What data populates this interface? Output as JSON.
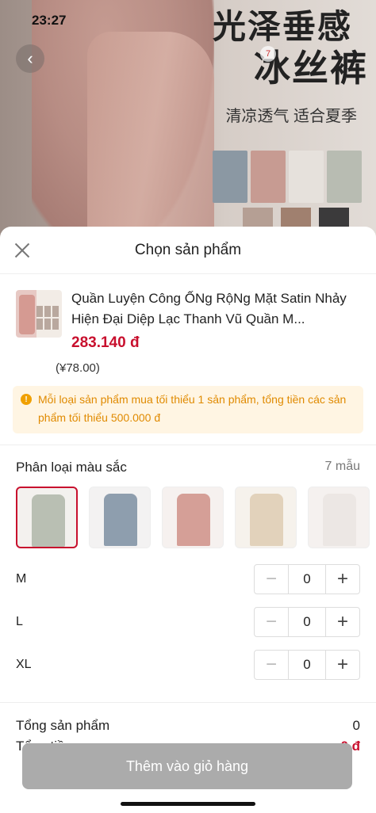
{
  "status_bar": {
    "time": "23:27"
  },
  "background": {
    "headline_line1": "光泽垂感",
    "headline_line2": "冰丝裤",
    "subline": "清凉透气 适合夏季",
    "image_counter": "7"
  },
  "sheet": {
    "title": "Chọn sản phẩm",
    "product": {
      "name": "Quần Luyện Công ỐNg RộNg Mặt Satin Nhảy Hiện Đại Diệp Lạc Thanh Vũ Quần M...",
      "price": "283.140 đ",
      "original_price": "(¥78.00)"
    },
    "notice": "Mỗi loại sản phẩm mua tối thiểu 1 sản phẩm, tổng tiền các sản phẩm tối thiểu 500.000 đ",
    "variant": {
      "title": "Phân loại màu sắc",
      "count": "7 mẫu",
      "colors": [
        "sage",
        "dusty-blue",
        "pink",
        "beige",
        "white"
      ]
    },
    "sizes": [
      {
        "label": "M",
        "qty": "0"
      },
      {
        "label": "L",
        "qty": "0"
      },
      {
        "label": "XL",
        "qty": "0"
      }
    ],
    "totals": {
      "products_label": "Tổng sản phẩm",
      "products_value": "0",
      "amount_label": "Tổng tiền",
      "amount_value": "0 đ"
    },
    "add_to_cart": "Thêm vào giỏ hàng"
  },
  "colors": {
    "accent_red": "#c8102e",
    "notice_orange": "#e08a00",
    "button_disabled": "#ababab"
  }
}
